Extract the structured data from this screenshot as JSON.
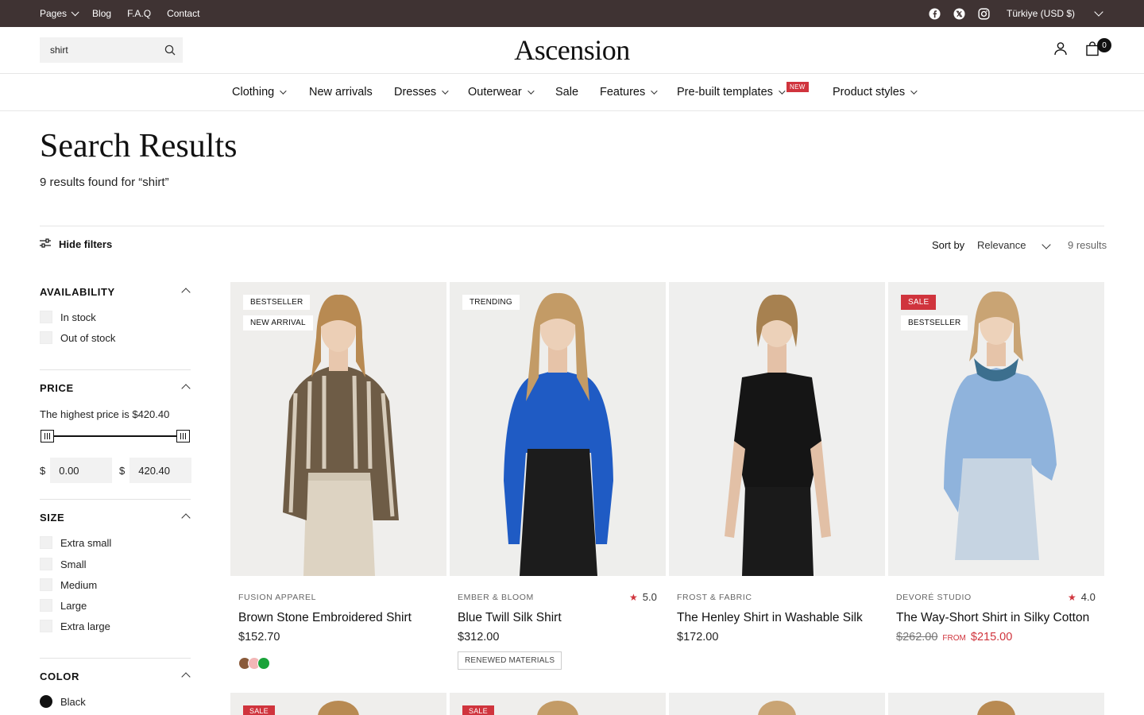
{
  "topbar": {
    "links": [
      {
        "label": "Pages",
        "has_dropdown": true
      },
      {
        "label": "Blog",
        "has_dropdown": false
      },
      {
        "label": "F.A.Q",
        "has_dropdown": false
      },
      {
        "label": "Contact",
        "has_dropdown": false
      }
    ],
    "social": [
      "facebook-icon",
      "x-icon",
      "instagram-icon"
    ],
    "locale": "Türkiye (USD $)"
  },
  "header": {
    "search_value": "shirt",
    "logo": "Ascension",
    "cart_count": "0"
  },
  "nav": [
    {
      "label": "Clothing",
      "dropdown": true
    },
    {
      "label": "New arrivals",
      "dropdown": false
    },
    {
      "label": "Dresses",
      "dropdown": true
    },
    {
      "label": "Outerwear",
      "dropdown": true
    },
    {
      "label": "Sale",
      "dropdown": false
    },
    {
      "label": "Features",
      "dropdown": true
    },
    {
      "label": "Pre-built templates",
      "dropdown": true,
      "badge": "NEW"
    },
    {
      "label": "Product styles",
      "dropdown": true
    }
  ],
  "page": {
    "title": "Search Results",
    "subtitle": "9 results found for “shirt”"
  },
  "toolbar": {
    "hide_filters": "Hide filters",
    "sort_label": "Sort by",
    "sort_value": "Relevance",
    "result_count": "9 results"
  },
  "filters": {
    "availability": {
      "title": "AVAILABILITY",
      "options": [
        "In stock",
        "Out of stock"
      ]
    },
    "price": {
      "title": "PRICE",
      "note": "The highest price is $420.40",
      "currency": "$",
      "min": "0.00",
      "max": "420.40"
    },
    "size": {
      "title": "SIZE",
      "options": [
        "Extra small",
        "Small",
        "Medium",
        "Large",
        "Extra large"
      ]
    },
    "color": {
      "title": "COLOR",
      "options": [
        {
          "label": "Black",
          "color": "#111111"
        }
      ]
    }
  },
  "products": [
    {
      "brand": "FUSION APPAREL",
      "name": "Brown Stone Embroidered Shirt",
      "price": "$152.70",
      "badges": [
        "BESTSELLER",
        "NEW ARRIVAL"
      ],
      "swatches": [
        "#8a5a3a",
        "#f2b6b6",
        "#1aa33a"
      ]
    },
    {
      "brand": "EMBER & BLOOM",
      "name": "Blue Twill Silk Shirt",
      "price": "$312.00",
      "rating": "5.0",
      "badges": [
        "TRENDING"
      ],
      "tag": "RENEWED MATERIALS"
    },
    {
      "brand": "FROST & FABRIC",
      "name": "The Henley Shirt in Washable Silk",
      "price": "$172.00",
      "badges": []
    },
    {
      "brand": "DEVORÉ STUDIO",
      "name": "The Way-Short Shirt in Silky Cotton",
      "compare_price": "$262.00",
      "from_label": "FROM",
      "sale_price": "$215.00",
      "rating": "4.0",
      "badges": [
        "SALE",
        "BESTSELLER"
      ]
    }
  ],
  "second_row": [
    {
      "badge": "SALE"
    },
    {
      "badge": "SALE"
    },
    {
      "badge": ""
    },
    {
      "badge": ""
    }
  ],
  "colors": {
    "topbar": "#3f3333",
    "accent_red": "#d0343d"
  }
}
